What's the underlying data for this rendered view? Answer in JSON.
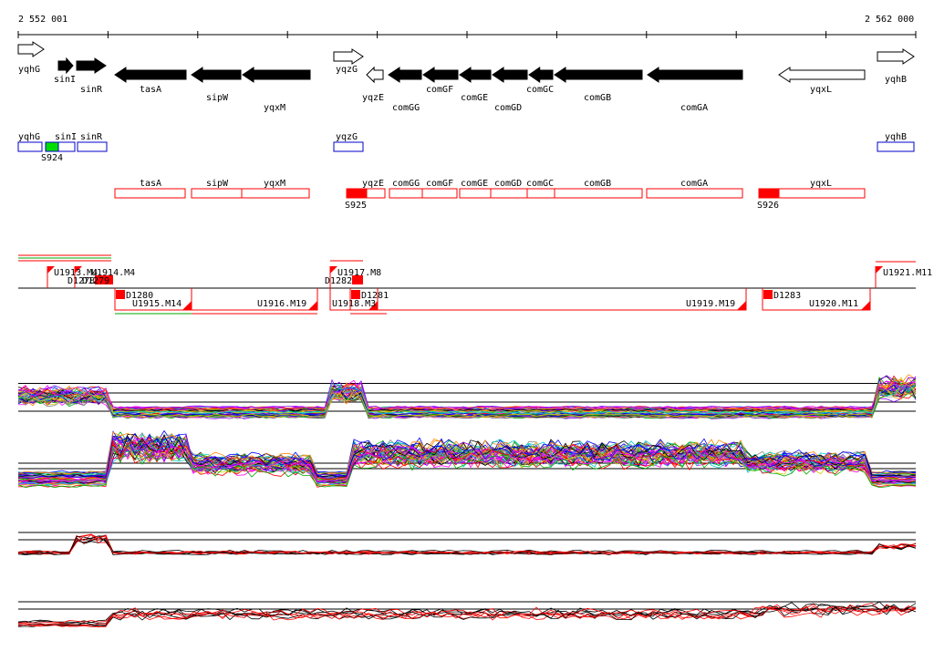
{
  "ruler": {
    "start_label": "2 552 001",
    "end_label": "2 562 000"
  },
  "genes": [
    {
      "name": "yqhG",
      "strand": "+",
      "fill": "white"
    },
    {
      "name": "sinI",
      "strand": "+",
      "fill": "black"
    },
    {
      "name": "sinR",
      "strand": "+",
      "fill": "black"
    },
    {
      "name": "tasA",
      "strand": "-",
      "fill": "black"
    },
    {
      "name": "sipW",
      "strand": "-",
      "fill": "black"
    },
    {
      "name": "yqxM",
      "strand": "-",
      "fill": "black"
    },
    {
      "name": "yqzG",
      "strand": "+",
      "fill": "white"
    },
    {
      "name": "yqzE",
      "strand": "-",
      "fill": "white"
    },
    {
      "name": "comGG",
      "strand": "-",
      "fill": "black"
    },
    {
      "name": "comGF",
      "strand": "-",
      "fill": "black"
    },
    {
      "name": "comGE",
      "strand": "-",
      "fill": "black"
    },
    {
      "name": "comGD",
      "strand": "-",
      "fill": "black"
    },
    {
      "name": "comGC",
      "strand": "-",
      "fill": "black"
    },
    {
      "name": "comGB",
      "strand": "-",
      "fill": "black"
    },
    {
      "name": "comGA",
      "strand": "-",
      "fill": "black"
    },
    {
      "name": "yqxL",
      "strand": "-",
      "fill": "white"
    },
    {
      "name": "yqhB",
      "strand": "+",
      "fill": "white"
    }
  ],
  "operons_plus": [
    {
      "gene": "yqhG"
    },
    {
      "gene": "sinI"
    },
    {
      "gene": "sinR"
    },
    {
      "gene": "yqzG"
    },
    {
      "gene": "yqhB"
    }
  ],
  "operons_minus": [
    {
      "gene": "tasA"
    },
    {
      "gene": "sipW"
    },
    {
      "gene": "yqxM"
    },
    {
      "gene": "yqzE"
    },
    {
      "gene": "comGG"
    },
    {
      "gene": "comGF"
    },
    {
      "gene": "comGE"
    },
    {
      "gene": "comGD"
    },
    {
      "gene": "comGC"
    },
    {
      "gene": "comGB"
    },
    {
      "gene": "comGA"
    },
    {
      "gene": "yqxL"
    }
  ],
  "promoter_labels": [
    "S924",
    "S925",
    "S926"
  ],
  "upshift_labels": [
    "U1913.M4",
    "U1914.M4",
    "U1917.M8",
    "U1921.M11"
  ],
  "downshift_labels": [
    "U1915.M14",
    "U1916.M19",
    "U1918.M3",
    "U1919.M19",
    "U1920.M11"
  ],
  "d_labels": [
    "D1278",
    "D1279",
    "D1280",
    "D1282",
    "D1281",
    "D1283"
  ],
  "track_colors": {
    "feature_red": "#ff0000",
    "feature_blue": "#0000cc",
    "promoter_green": "#00dd00",
    "profile_palette": [
      "#000000",
      "#ff0000",
      "#00aa00",
      "#0000ff",
      "#ff00ff",
      "#00cccc",
      "#cccc00",
      "#ff8800",
      "#8800ff",
      "#888888"
    ]
  }
}
